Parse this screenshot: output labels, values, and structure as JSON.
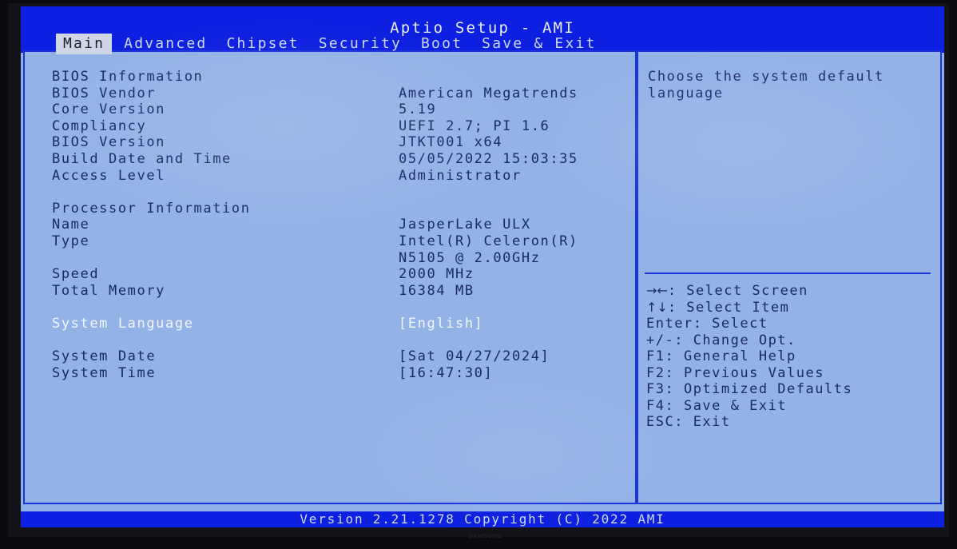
{
  "window": {
    "title": "Aptio Setup - AMI",
    "brand": "SAMSUNG"
  },
  "menu": {
    "items": [
      {
        "label": "Main",
        "active": true
      },
      {
        "label": "Advanced",
        "active": false
      },
      {
        "label": "Chipset",
        "active": false
      },
      {
        "label": "Security",
        "active": false
      },
      {
        "label": "Boot",
        "active": false
      },
      {
        "label": "Save & Exit",
        "active": false
      }
    ]
  },
  "main": {
    "rows": [
      {
        "label": "BIOS Information",
        "value": "",
        "selected": false
      },
      {
        "label": "BIOS Vendor",
        "value": "American Megatrends",
        "selected": false
      },
      {
        "label": "Core Version",
        "value": "5.19",
        "selected": false
      },
      {
        "label": "Compliancy",
        "value": "UEFI 2.7; PI 1.6",
        "selected": false
      },
      {
        "label": "BIOS Version",
        "value": "JTKT001 x64",
        "selected": false
      },
      {
        "label": "Build Date and Time",
        "value": "05/05/2022 15:03:35",
        "selected": false
      },
      {
        "label": "Access Level",
        "value": "Administrator",
        "selected": false
      },
      {
        "label": "",
        "value": "",
        "selected": false
      },
      {
        "label": "Processor Information",
        "value": "",
        "selected": false
      },
      {
        "label": "Name",
        "value": "JasperLake ULX",
        "selected": false
      },
      {
        "label": "Type",
        "value": "Intel(R) Celeron(R)",
        "selected": false
      },
      {
        "label": "",
        "value": "N5105 @ 2.00GHz",
        "selected": false
      },
      {
        "label": "Speed",
        "value": "2000 MHz",
        "selected": false
      },
      {
        "label": "Total Memory",
        "value": "16384 MB",
        "selected": false
      },
      {
        "label": "",
        "value": "",
        "selected": false
      },
      {
        "label": "System Language",
        "value": "[English]",
        "selected": true
      },
      {
        "label": "",
        "value": "",
        "selected": false
      },
      {
        "label": "System Date",
        "value": "[Sat 04/27/2024]",
        "selected": false
      },
      {
        "label": "System Time",
        "value": "[16:47:30]",
        "selected": false
      }
    ]
  },
  "help": {
    "lines": [
      "Choose the system default",
      "language"
    ]
  },
  "key_legend": {
    "entries": [
      {
        "keys": "→←",
        "glyph": true,
        "text": ": Select Screen"
      },
      {
        "keys": "↑↓",
        "glyph": true,
        "text": ": Select Item"
      },
      {
        "keys": "Enter",
        "glyph": false,
        "text": ": Select"
      },
      {
        "keys": "+/-",
        "glyph": false,
        "text": ": Change Opt."
      },
      {
        "keys": "F1",
        "glyph": false,
        "text": ": General Help"
      },
      {
        "keys": "F2",
        "glyph": false,
        "text": ": Previous Values"
      },
      {
        "keys": "F3",
        "glyph": false,
        "text": ": Optimized Defaults"
      },
      {
        "keys": "F4",
        "glyph": false,
        "text": ": Save & Exit"
      },
      {
        "keys": "ESC",
        "glyph": false,
        "text": ": Exit"
      }
    ]
  },
  "footer": {
    "text": "Version 2.21.1278 Copyright (C) 2022 AMI"
  },
  "colors": {
    "screen_blue": "#0d1fe0",
    "panel_bg": "#93b2e6",
    "panel_border": "#1b34d8",
    "text_navy": "#192a66",
    "text_selected": "#f2f6ff",
    "tab_active_bg": "#cfd7e4"
  }
}
